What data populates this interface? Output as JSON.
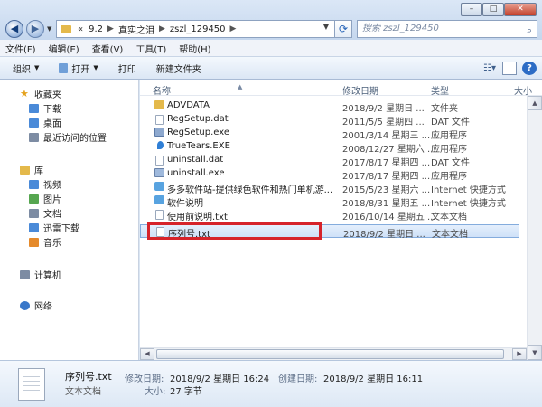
{
  "window": {
    "minimize": "–",
    "maximize": "□",
    "close": "✕"
  },
  "address": {
    "prefix": "«",
    "crumbs": [
      "9.2",
      "真实之泪",
      "zszl_129450"
    ],
    "search_placeholder": "搜索 zszl_129450"
  },
  "menu": [
    "文件(F)",
    "编辑(E)",
    "查看(V)",
    "工具(T)",
    "帮助(H)"
  ],
  "toolbar": {
    "organize": "组织",
    "open": "打开",
    "print": "打印",
    "new_folder": "新建文件夹"
  },
  "sidebar": {
    "favorites": "收藏夹",
    "fav_items": [
      "下载",
      "桌面",
      "最近访问的位置"
    ],
    "libraries": "库",
    "lib_items": [
      "视频",
      "图片",
      "文档",
      "迅雷下载",
      "音乐"
    ],
    "computer": "计算机",
    "network": "网络"
  },
  "columns": {
    "name": "名称",
    "date": "修改日期",
    "type": "类型",
    "size": "大小"
  },
  "files": [
    {
      "name": "ADVDATA",
      "date": "2018/9/2 星期日 ...",
      "type": "文件夹",
      "icon": "folder"
    },
    {
      "name": "RegSetup.dat",
      "date": "2011/5/5 星期四 ...",
      "type": "DAT 文件",
      "icon": "file"
    },
    {
      "name": "RegSetup.exe",
      "date": "2001/3/14 星期三 ...",
      "type": "应用程序",
      "icon": "exe"
    },
    {
      "name": "TrueTears.EXE",
      "date": "2008/12/27 星期六 ...",
      "type": "应用程序",
      "icon": "tear"
    },
    {
      "name": "uninstall.dat",
      "date": "2017/8/17 星期四 ...",
      "type": "DAT 文件",
      "icon": "file"
    },
    {
      "name": "uninstall.exe",
      "date": "2017/8/17 星期四 ...",
      "type": "应用程序",
      "icon": "uninst"
    },
    {
      "name": "多多软件站-提供绿色软件和热门单机游...",
      "date": "2015/5/23 星期六 ...",
      "type": "Internet 快捷方式",
      "icon": "link"
    },
    {
      "name": "软件说明",
      "date": "2018/8/31 星期五 ...",
      "type": "Internet 快捷方式",
      "icon": "link"
    },
    {
      "name": "使用前说明.txt",
      "date": "2016/10/14 星期五 ...",
      "type": "文本文档",
      "icon": "file"
    },
    {
      "name": "序列号.txt",
      "date": "2018/9/2 星期日 ...",
      "type": "文本文档",
      "icon": "file"
    }
  ],
  "details": {
    "filename": "序列号.txt",
    "filetype": "文本文档",
    "modified_label": "修改日期:",
    "modified_value": "2018/9/2 星期日 16:24",
    "created_label": "创建日期:",
    "created_value": "2018/9/2 星期日 16:11",
    "size_label": "大小:",
    "size_value": "27 字节"
  },
  "colors": {
    "highlight": "#d6232a",
    "selection": "#cfe1f8"
  }
}
